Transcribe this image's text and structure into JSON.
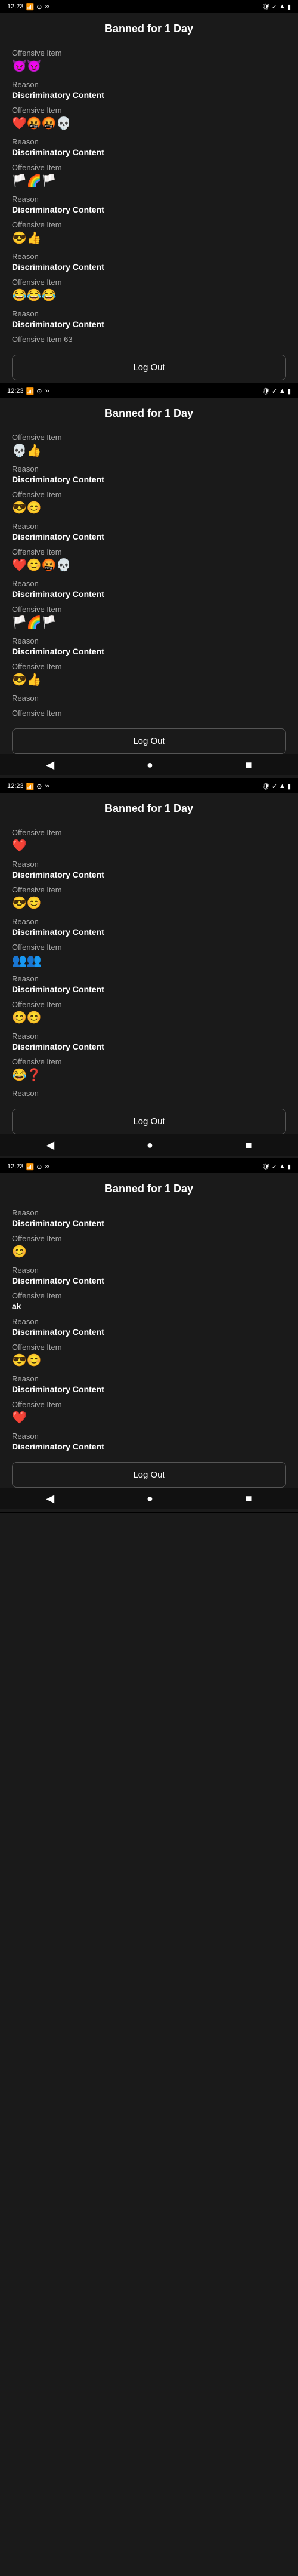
{
  "screens": [
    {
      "id": "screen1",
      "header": "Banned for 1 Day",
      "statusBar": {
        "time": "12:23",
        "left": [
          "signal",
          "wifi",
          "battery"
        ],
        "right": [
          "lock",
          "check",
          "wifi-signal",
          "battery"
        ]
      },
      "items": [
        {
          "label": "Offensive Item",
          "value": "😈😈"
        },
        {
          "label": "Reason",
          "value": "Discriminatory Content"
        },
        {
          "label": "Offensive Item",
          "value": "❤️🤬🤬💀"
        },
        {
          "label": "Reason",
          "value": "Discriminatory Content"
        },
        {
          "label": "Offensive Item",
          "value": "🏳️🌈🏳️"
        },
        {
          "label": "Reason",
          "value": "Discriminatory Content"
        },
        {
          "label": "Offensive Item",
          "value": "😎👍"
        },
        {
          "label": "Reason",
          "value": "Discriminatory Content"
        },
        {
          "label": "Offensive Item",
          "value": "😂😂😂"
        },
        {
          "label": "Reason",
          "value": "Discriminatory Content"
        },
        {
          "label": "Offensive Item 63",
          "value": ""
        }
      ],
      "logoutLabel": "Log Out",
      "showNavBar": false
    },
    {
      "id": "screen2",
      "header": "Banned for 1 Day",
      "statusBar": {
        "time": "12:23",
        "left": [
          "signal",
          "wifi",
          "battery"
        ],
        "right": [
          "lock",
          "check",
          "wifi-signal",
          "battery"
        ]
      },
      "items": [
        {
          "label": "Offensive Item",
          "value": "💀👍"
        },
        {
          "label": "Reason",
          "value": "Discriminatory Content"
        },
        {
          "label": "Offensive Item",
          "value": "😎😊"
        },
        {
          "label": "Reason",
          "value": "Discriminatory Content"
        },
        {
          "label": "Offensive Item",
          "value": "❤️😊🤬💀"
        },
        {
          "label": "Reason",
          "value": "Discriminatory Content"
        },
        {
          "label": "Offensive Item",
          "value": "🏳️🌈🏳️"
        },
        {
          "label": "Reason",
          "value": "Discriminatory Content"
        },
        {
          "label": "Offensive Item",
          "value": "😎👍"
        },
        {
          "label": "Reason",
          "value": ""
        },
        {
          "label": "Offensive Item",
          "value": ""
        }
      ],
      "logoutLabel": "Log Out",
      "showNavBar": true
    },
    {
      "id": "screen3",
      "header": "Banned for 1 Day",
      "statusBar": {
        "time": "12:23",
        "left": [
          "signal",
          "wifi",
          "battery"
        ],
        "right": [
          "lock",
          "check",
          "wifi-signal",
          "battery"
        ]
      },
      "items": [
        {
          "label": "Offensive Item",
          "value": "❤️"
        },
        {
          "label": "Reason",
          "value": "Discriminatory Content"
        },
        {
          "label": "Offensive Item",
          "value": "😎😊"
        },
        {
          "label": "Reason",
          "value": "Discriminatory Content"
        },
        {
          "label": "Offensive Item",
          "value": "👥👥"
        },
        {
          "label": "Reason",
          "value": "Discriminatory Content"
        },
        {
          "label": "Offensive Item",
          "value": "😊😊"
        },
        {
          "label": "Reason",
          "value": "Discriminatory Content"
        },
        {
          "label": "Offensive Item",
          "value": "😂❓"
        },
        {
          "label": "Reason",
          "value": ""
        }
      ],
      "logoutLabel": "Log Out",
      "showNavBar": true
    },
    {
      "id": "screen4",
      "header": "Banned for 1 Day",
      "statusBar": {
        "time": "12:23",
        "left": [
          "signal",
          "wifi",
          "battery"
        ],
        "right": [
          "lock",
          "check",
          "wifi-signal",
          "battery"
        ]
      },
      "items": [
        {
          "label": "Reason",
          "value": "Discriminatory Content"
        },
        {
          "label": "Offensive Item",
          "value": "😊"
        },
        {
          "label": "Reason",
          "value": "Discriminatory Content"
        },
        {
          "label": "Offensive Item",
          "value": "ak"
        },
        {
          "label": "Reason",
          "value": "Discriminatory Content"
        },
        {
          "label": "Offensive Item",
          "value": "😎😊"
        },
        {
          "label": "Reason",
          "value": "Discriminatory Content"
        },
        {
          "label": "Offensive Item",
          "value": "❤️"
        },
        {
          "label": "Reason",
          "value": "Discriminatory Content"
        }
      ],
      "logoutLabel": "Log Out",
      "showNavBar": true
    }
  ],
  "navButtons": [
    "◀",
    "●",
    "■"
  ]
}
